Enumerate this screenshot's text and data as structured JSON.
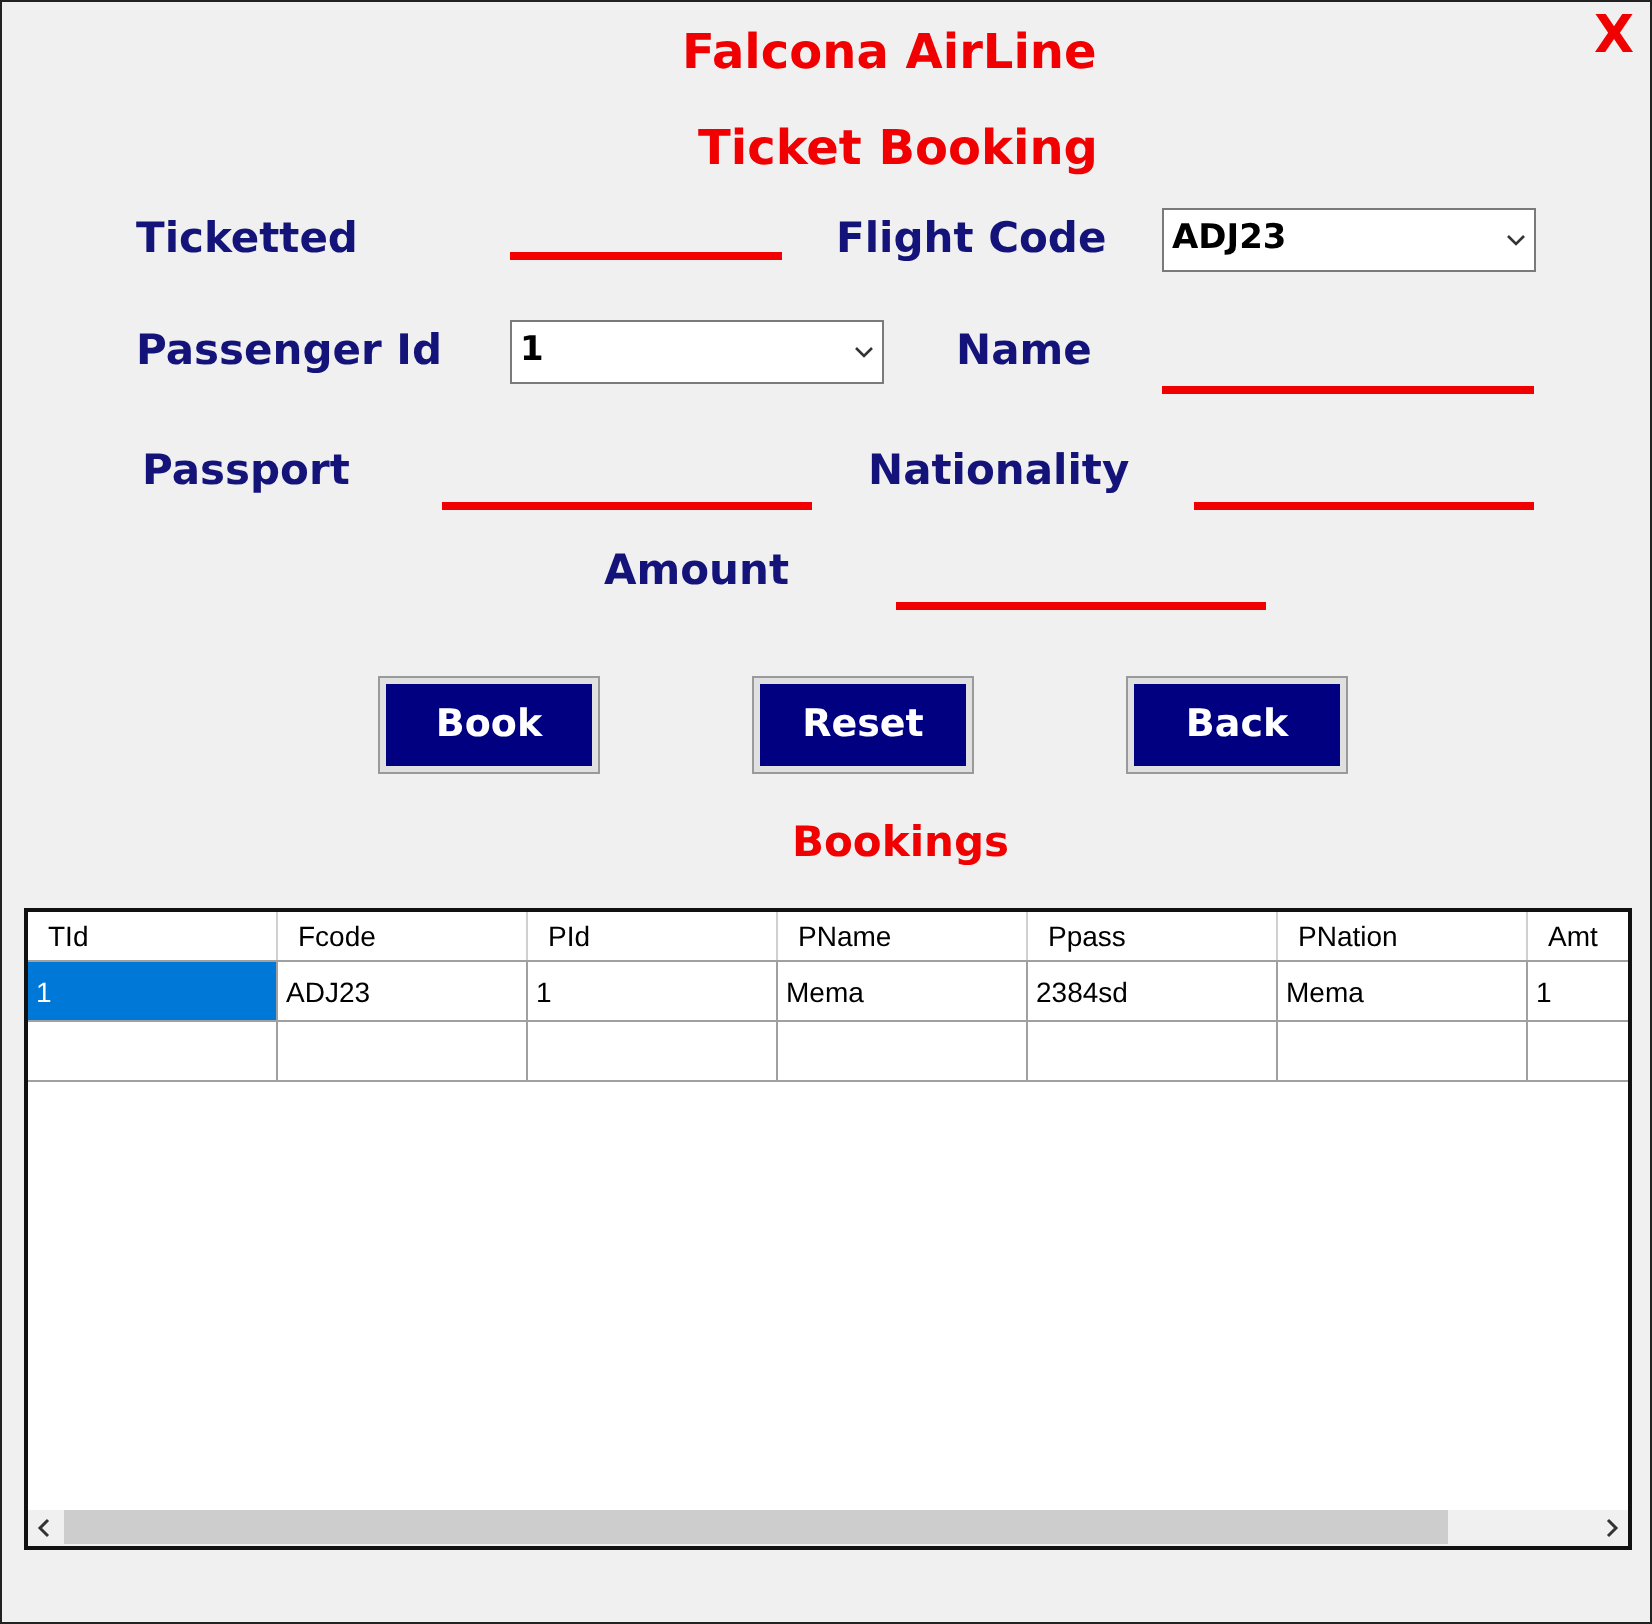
{
  "window": {
    "title": "Falcona AirLine",
    "close": "X"
  },
  "heading": "Ticket Booking",
  "fields": [
    {
      "label": "Ticketted",
      "kind": "line"
    },
    {
      "label": "Flight Code",
      "kind": "combo",
      "value": "ADJ23"
    },
    {
      "label": "Passenger Id",
      "kind": "combo",
      "value": "1"
    },
    {
      "label": "Name",
      "kind": "line"
    },
    {
      "label": "Passport",
      "kind": "line"
    },
    {
      "label": "Nationality",
      "kind": "line"
    },
    {
      "label": "Amount",
      "kind": "line"
    }
  ],
  "buttons": [
    "Book",
    "Reset",
    "Back"
  ],
  "table": {
    "title": "Bookings",
    "columns": [
      "TId",
      "Fcode",
      "PId",
      "PName",
      "Ppass",
      "PNation",
      "Amt"
    ],
    "rows": [
      {
        "cells": [
          {
            "text": "1",
            "selected": true
          },
          {
            "text": "ADJ23",
            "selected": false
          },
          {
            "text": "1",
            "selected": false
          },
          {
            "text": "Mema",
            "selected": false
          },
          {
            "text": "2384sd",
            "selected": false
          },
          {
            "text": "Mema",
            "selected": false
          },
          {
            "text": "1",
            "selected": false
          }
        ]
      }
    ]
  }
}
